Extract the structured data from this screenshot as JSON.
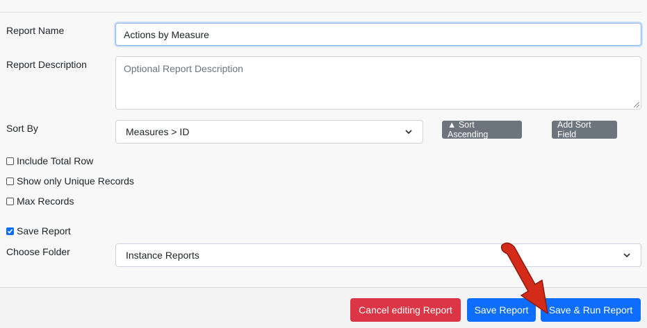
{
  "form": {
    "report_name": {
      "label": "Report Name",
      "value": "Actions by Measure"
    },
    "report_description": {
      "label": "Report Description",
      "placeholder": "Optional Report Description"
    },
    "sort_by": {
      "label": "Sort By",
      "selected": "Measures > ID",
      "sort_button": "▲ Sort Ascending",
      "add_button": "Add Sort Field"
    },
    "checkboxes": [
      {
        "label": "Include Total Row",
        "checked": false
      },
      {
        "label": "Show only Unique Records",
        "checked": false
      },
      {
        "label": "Max Records",
        "checked": false
      }
    ],
    "save_report": {
      "label": "Save Report",
      "checked": true
    },
    "choose_folder": {
      "label": "Choose Folder",
      "selected": "Instance Reports"
    }
  },
  "footer": {
    "cancel_label": "Cancel editing Report",
    "save_label": "Save Report",
    "save_run_label": "Save & Run Report"
  },
  "colors": {
    "primary": "#0d6efd",
    "danger": "#dc3545",
    "secondary": "#6c757d",
    "annotation_arrow": "#d42a1a"
  },
  "icons": {
    "select_chevron": "chevron-down-icon",
    "annotation": "red-arrow-annotation"
  }
}
